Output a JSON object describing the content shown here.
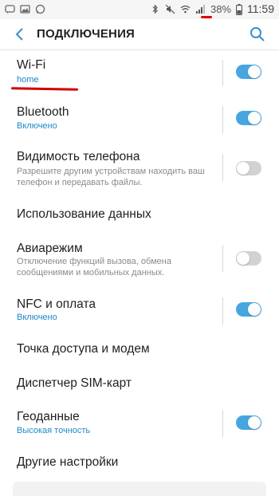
{
  "status_bar": {
    "battery": "38%",
    "time": "11:59",
    "left_icons": [
      "message-icon",
      "image-icon",
      "whatsapp-icon"
    ],
    "right_icons": [
      "bluetooth-icon",
      "mute-icon",
      "wifi-icon",
      "signal-icon",
      "battery-icon"
    ]
  },
  "app_bar": {
    "title": "ПОДКЛЮЧЕНИЯ"
  },
  "settings": {
    "wifi": {
      "title": "Wi-Fi",
      "subtitle": "home",
      "enabled": true
    },
    "bluetooth": {
      "title": "Bluetooth",
      "subtitle": "Включено",
      "enabled": true
    },
    "visibility": {
      "title": "Видимость телефона",
      "description": "Разрешите другим устройствам находить ваш телефон и передавать файлы.",
      "enabled": false
    },
    "data_usage": {
      "title": "Использование данных"
    },
    "airplane": {
      "title": "Авиарежим",
      "description": "Отключение функций вызова, обмена сообщениями и мобильных данных.",
      "enabled": false
    },
    "nfc": {
      "title": "NFC и оплата",
      "subtitle": "Включено",
      "enabled": true
    },
    "hotspot": {
      "title": "Точка доступа и модем"
    },
    "sim_manager": {
      "title": "Диспетчер SIM-карт"
    },
    "location": {
      "title": "Геоданные",
      "subtitle": "Высокая точность",
      "enabled": true
    },
    "more": {
      "title": "Другие настройки"
    }
  },
  "colors": {
    "accent": "#47a6e0",
    "subtitle": "#1e88c8",
    "annotation": "#d00000"
  }
}
